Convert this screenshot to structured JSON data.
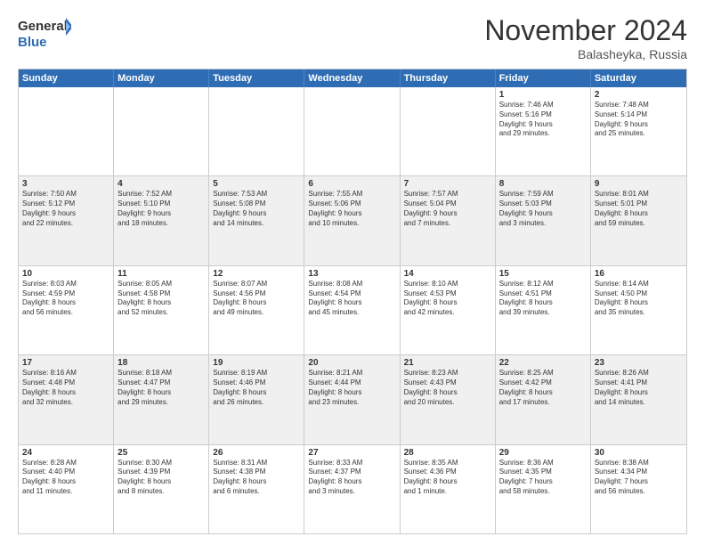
{
  "logo": {
    "line1": "General",
    "line2": "Blue"
  },
  "title": "November 2024",
  "subtitle": "Balasheyka, Russia",
  "header_days": [
    "Sunday",
    "Monday",
    "Tuesday",
    "Wednesday",
    "Thursday",
    "Friday",
    "Saturday"
  ],
  "rows": [
    {
      "alt": false,
      "cells": [
        {
          "day": "",
          "info": ""
        },
        {
          "day": "",
          "info": ""
        },
        {
          "day": "",
          "info": ""
        },
        {
          "day": "",
          "info": ""
        },
        {
          "day": "",
          "info": ""
        },
        {
          "day": "1",
          "info": "Sunrise: 7:46 AM\nSunset: 5:16 PM\nDaylight: 9 hours\nand 29 minutes."
        },
        {
          "day": "2",
          "info": "Sunrise: 7:48 AM\nSunset: 5:14 PM\nDaylight: 9 hours\nand 25 minutes."
        }
      ]
    },
    {
      "alt": true,
      "cells": [
        {
          "day": "3",
          "info": "Sunrise: 7:50 AM\nSunset: 5:12 PM\nDaylight: 9 hours\nand 22 minutes."
        },
        {
          "day": "4",
          "info": "Sunrise: 7:52 AM\nSunset: 5:10 PM\nDaylight: 9 hours\nand 18 minutes."
        },
        {
          "day": "5",
          "info": "Sunrise: 7:53 AM\nSunset: 5:08 PM\nDaylight: 9 hours\nand 14 minutes."
        },
        {
          "day": "6",
          "info": "Sunrise: 7:55 AM\nSunset: 5:06 PM\nDaylight: 9 hours\nand 10 minutes."
        },
        {
          "day": "7",
          "info": "Sunrise: 7:57 AM\nSunset: 5:04 PM\nDaylight: 9 hours\nand 7 minutes."
        },
        {
          "day": "8",
          "info": "Sunrise: 7:59 AM\nSunset: 5:03 PM\nDaylight: 9 hours\nand 3 minutes."
        },
        {
          "day": "9",
          "info": "Sunrise: 8:01 AM\nSunset: 5:01 PM\nDaylight: 8 hours\nand 59 minutes."
        }
      ]
    },
    {
      "alt": false,
      "cells": [
        {
          "day": "10",
          "info": "Sunrise: 8:03 AM\nSunset: 4:59 PM\nDaylight: 8 hours\nand 56 minutes."
        },
        {
          "day": "11",
          "info": "Sunrise: 8:05 AM\nSunset: 4:58 PM\nDaylight: 8 hours\nand 52 minutes."
        },
        {
          "day": "12",
          "info": "Sunrise: 8:07 AM\nSunset: 4:56 PM\nDaylight: 8 hours\nand 49 minutes."
        },
        {
          "day": "13",
          "info": "Sunrise: 8:08 AM\nSunset: 4:54 PM\nDaylight: 8 hours\nand 45 minutes."
        },
        {
          "day": "14",
          "info": "Sunrise: 8:10 AM\nSunset: 4:53 PM\nDaylight: 8 hours\nand 42 minutes."
        },
        {
          "day": "15",
          "info": "Sunrise: 8:12 AM\nSunset: 4:51 PM\nDaylight: 8 hours\nand 39 minutes."
        },
        {
          "day": "16",
          "info": "Sunrise: 8:14 AM\nSunset: 4:50 PM\nDaylight: 8 hours\nand 35 minutes."
        }
      ]
    },
    {
      "alt": true,
      "cells": [
        {
          "day": "17",
          "info": "Sunrise: 8:16 AM\nSunset: 4:48 PM\nDaylight: 8 hours\nand 32 minutes."
        },
        {
          "day": "18",
          "info": "Sunrise: 8:18 AM\nSunset: 4:47 PM\nDaylight: 8 hours\nand 29 minutes."
        },
        {
          "day": "19",
          "info": "Sunrise: 8:19 AM\nSunset: 4:46 PM\nDaylight: 8 hours\nand 26 minutes."
        },
        {
          "day": "20",
          "info": "Sunrise: 8:21 AM\nSunset: 4:44 PM\nDaylight: 8 hours\nand 23 minutes."
        },
        {
          "day": "21",
          "info": "Sunrise: 8:23 AM\nSunset: 4:43 PM\nDaylight: 8 hours\nand 20 minutes."
        },
        {
          "day": "22",
          "info": "Sunrise: 8:25 AM\nSunset: 4:42 PM\nDaylight: 8 hours\nand 17 minutes."
        },
        {
          "day": "23",
          "info": "Sunrise: 8:26 AM\nSunset: 4:41 PM\nDaylight: 8 hours\nand 14 minutes."
        }
      ]
    },
    {
      "alt": false,
      "cells": [
        {
          "day": "24",
          "info": "Sunrise: 8:28 AM\nSunset: 4:40 PM\nDaylight: 8 hours\nand 11 minutes."
        },
        {
          "day": "25",
          "info": "Sunrise: 8:30 AM\nSunset: 4:39 PM\nDaylight: 8 hours\nand 8 minutes."
        },
        {
          "day": "26",
          "info": "Sunrise: 8:31 AM\nSunset: 4:38 PM\nDaylight: 8 hours\nand 6 minutes."
        },
        {
          "day": "27",
          "info": "Sunrise: 8:33 AM\nSunset: 4:37 PM\nDaylight: 8 hours\nand 3 minutes."
        },
        {
          "day": "28",
          "info": "Sunrise: 8:35 AM\nSunset: 4:36 PM\nDaylight: 8 hours\nand 1 minute."
        },
        {
          "day": "29",
          "info": "Sunrise: 8:36 AM\nSunset: 4:35 PM\nDaylight: 7 hours\nand 58 minutes."
        },
        {
          "day": "30",
          "info": "Sunrise: 8:38 AM\nSunset: 4:34 PM\nDaylight: 7 hours\nand 56 minutes."
        }
      ]
    }
  ]
}
